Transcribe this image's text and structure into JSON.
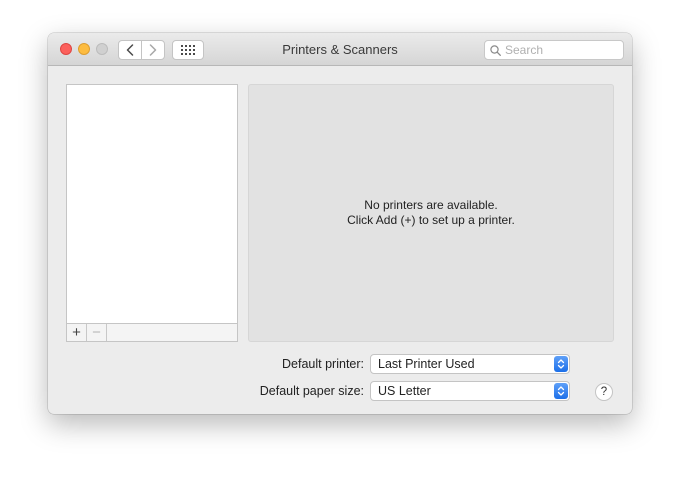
{
  "window": {
    "title": "Printers & Scanners",
    "search": {
      "placeholder": "Search",
      "value": ""
    },
    "toolbar": {
      "back_icon": "chevron-left-icon",
      "forward_icon": "chevron-right-icon",
      "grid_icon": "grid-dots-icon"
    }
  },
  "printer_list": {
    "add_label": "+",
    "remove_label": "−"
  },
  "detail": {
    "message_line1": "No printers are available.",
    "message_line2": "Click Add (+) to set up a printer."
  },
  "settings": {
    "default_printer": {
      "label": "Default printer:",
      "value": "Last Printer Used"
    },
    "default_paper_size": {
      "label": "Default paper size:",
      "value": "US Letter"
    }
  },
  "help": {
    "label": "?"
  },
  "colors": {
    "close": "#fc605c",
    "minimize": "#fdbc40",
    "zoom_disabled": "#d0d0d0",
    "popup_accent": "#1c6fe9",
    "detail_bg": "#e2e2e2"
  }
}
